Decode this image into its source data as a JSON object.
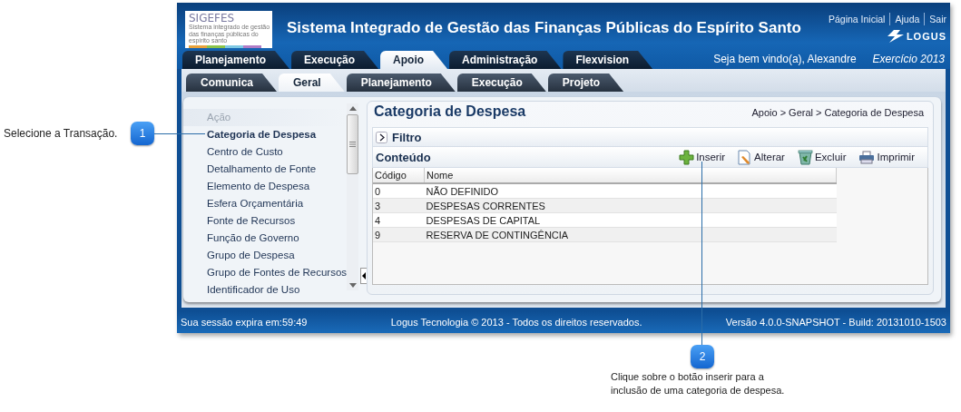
{
  "callouts": [
    {
      "number": "1",
      "text": "Selecione a Transação."
    },
    {
      "number": "2",
      "text": "Clique sobre o botão inserir para a inclusão de uma categoria de despesa."
    }
  ],
  "header": {
    "logo": {
      "title": "SIGEFES",
      "subtitle": "Sistema integrado de gestão das finanças públicas do espírito santo"
    },
    "title": "Sistema Integrado de Gestão das Finanças Públicas do Espírito Santo",
    "links": [
      "Página Inicial",
      "Ajuda",
      "Sair"
    ],
    "brand": "LOGUS",
    "welcome": "Seja bem vindo(a), Alexandre",
    "exercise": "Exercício 2013"
  },
  "main_tabs": [
    {
      "label": "Planejamento",
      "selected": false
    },
    {
      "label": "Execução",
      "selected": false
    },
    {
      "label": "Apoio",
      "selected": true
    },
    {
      "label": "Administração",
      "selected": false
    },
    {
      "label": "Flexvision",
      "selected": false
    }
  ],
  "sub_tabs": [
    {
      "label": "Comunica",
      "selected": false
    },
    {
      "label": "Geral",
      "selected": true
    },
    {
      "label": "Planejamento",
      "selected": false
    },
    {
      "label": "Execução",
      "selected": false
    },
    {
      "label": "Projeto",
      "selected": false
    }
  ],
  "sidebar": {
    "heading": "Ação",
    "items": [
      {
        "label": "Categoria de Despesa",
        "selected": true
      },
      {
        "label": "Centro de Custo",
        "selected": false
      },
      {
        "label": "Detalhamento de Fonte",
        "selected": false
      },
      {
        "label": "Elemento de Despesa",
        "selected": false
      },
      {
        "label": "Esfera Orçamentária",
        "selected": false
      },
      {
        "label": "Fonte de Recursos",
        "selected": false
      },
      {
        "label": "Função de Governo",
        "selected": false
      },
      {
        "label": "Grupo de Despesa",
        "selected": false
      },
      {
        "label": "Grupo de Fontes de Recursos",
        "selected": false
      },
      {
        "label": "Identificador de Uso",
        "selected": false
      }
    ]
  },
  "content": {
    "title": "Categoria de Despesa",
    "breadcrumb": "Apoio > Geral > Categoria de Despesa",
    "filter": {
      "label": "Filtro",
      "expanded": false
    },
    "section": "Conteúdo",
    "actions": [
      {
        "kind": "add",
        "label": "Inserir"
      },
      {
        "kind": "edit",
        "label": "Alterar"
      },
      {
        "kind": "delete",
        "label": "Excluir"
      },
      {
        "kind": "print",
        "label": "Imprimir"
      }
    ],
    "table": {
      "columns": [
        "Código",
        "Nome"
      ],
      "rows": [
        [
          "0",
          "NÃO DEFINIDO"
        ],
        [
          "3",
          "DESPESAS CORRENTES"
        ],
        [
          "4",
          "DESPESAS DE CAPITAL"
        ],
        [
          "9",
          "RESERVA DE CONTINGÊNCIA"
        ]
      ]
    }
  },
  "status_bar": {
    "session": "Sua sessão expira em:59:49",
    "copyright": "Logus Tecnologia © 2013 - Todos os direitos reservados.",
    "version": "Versão 4.0.0-SNAPSHOT - Build: 20131010-1503"
  }
}
